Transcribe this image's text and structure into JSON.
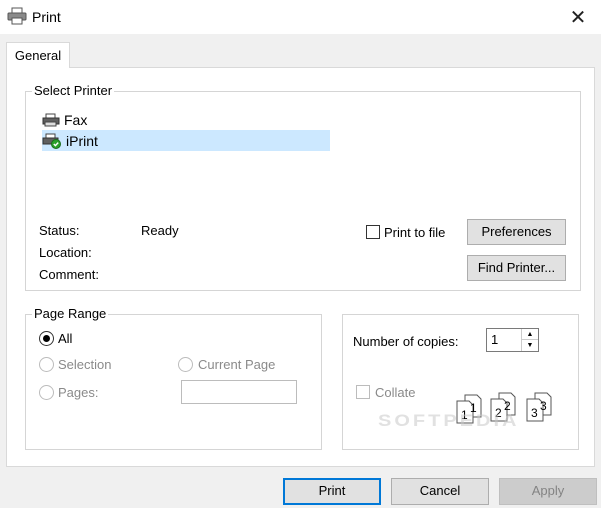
{
  "window": {
    "title": "Print"
  },
  "tabs": [
    {
      "label": "General"
    }
  ],
  "select_printer": {
    "legend": "Select Printer",
    "printers": [
      {
        "name": "Fax",
        "icon": "fax-printer-icon",
        "selected": false
      },
      {
        "name": "iPrint",
        "icon": "printer-ready-icon",
        "selected": true
      }
    ],
    "status_label": "Status:",
    "status_value": "Ready",
    "location_label": "Location:",
    "comment_label": "Comment:",
    "print_to_file_label": "Print to file",
    "preferences_button": "Preferences",
    "find_printer_button": "Find Printer..."
  },
  "page_range": {
    "legend": "Page Range",
    "all_label": "All",
    "selection_label": "Selection",
    "current_page_label": "Current Page",
    "pages_label": "Pages:",
    "pages_value": "",
    "selected_option": "All"
  },
  "copies": {
    "number_label": "Number of copies:",
    "number_value": "1",
    "collate_label": "Collate",
    "collate_checked": false
  },
  "footer": {
    "print_button": "Print",
    "cancel_button": "Cancel",
    "apply_button": "Apply"
  },
  "watermark": "SOFTPEDIA"
}
